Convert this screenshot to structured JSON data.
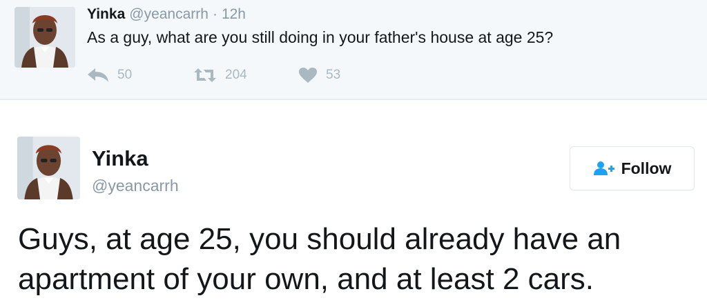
{
  "colors": {
    "timeline_bg": "#f5f8fa",
    "divider": "#e6ecf0",
    "text_primary": "#14171a",
    "text_secondary": "#8899a6",
    "action_icon": "#aab8c2",
    "follow_icon": "#1da1f2"
  },
  "tweet1": {
    "name": "Yinka",
    "handle": "@yeancarrh",
    "separator": "·",
    "time": "12h",
    "text": "As a guy, what are you still doing in your father's house at age 25?",
    "avatar_icon": "profile-photo",
    "actions": {
      "reply": {
        "icon": "reply-icon",
        "count": "50"
      },
      "retweet": {
        "icon": "retweet-icon",
        "count": "204"
      },
      "like": {
        "icon": "heart-icon",
        "count": "53"
      }
    }
  },
  "tweet2": {
    "name": "Yinka",
    "handle": "@yeancarrh",
    "avatar_icon": "profile-photo",
    "follow_button": {
      "icon": "add-user-icon",
      "label": "Follow"
    },
    "text_lines": [
      "Guys, at age 25, you should already have an",
      "apartment of your own, and at least 2 cars."
    ]
  }
}
